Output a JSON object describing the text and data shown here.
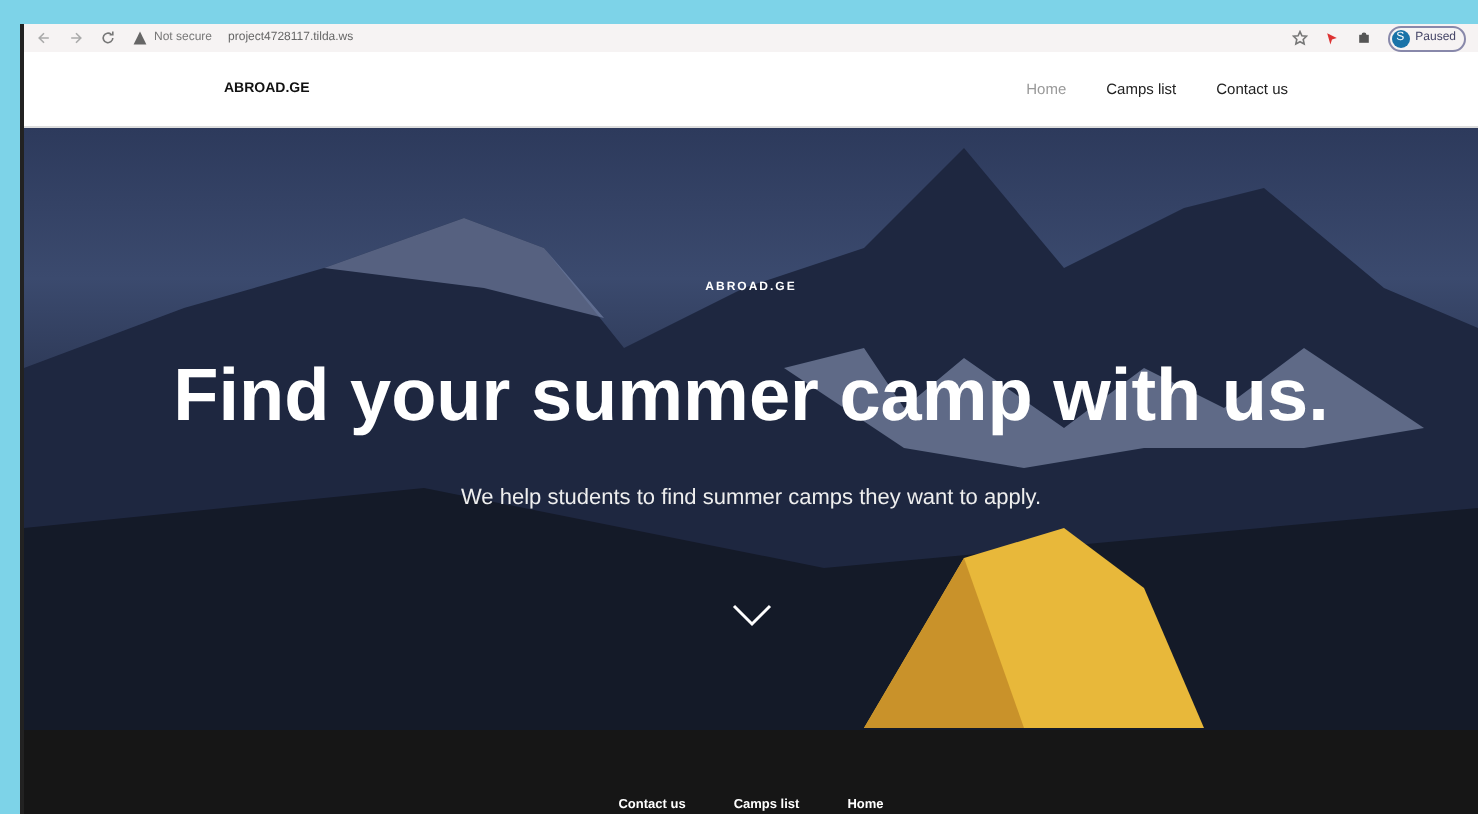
{
  "browser": {
    "security": "Not secure",
    "url": "project4728117.tilda.ws",
    "profile_initial": "S",
    "profile_status": "Paused"
  },
  "header": {
    "logo": "ABROAD.GE",
    "nav": [
      {
        "label": "Home",
        "selected": true
      },
      {
        "label": "Camps list",
        "selected": false
      },
      {
        "label": "Contact us",
        "selected": false
      }
    ]
  },
  "hero": {
    "eyebrow": "ABROAD.GE",
    "title": "Find your summer camp with us.",
    "subtitle": "We help students to find summer camps they want to apply."
  },
  "footer": {
    "links": [
      "Contact us",
      "Camps list",
      "Home"
    ]
  }
}
